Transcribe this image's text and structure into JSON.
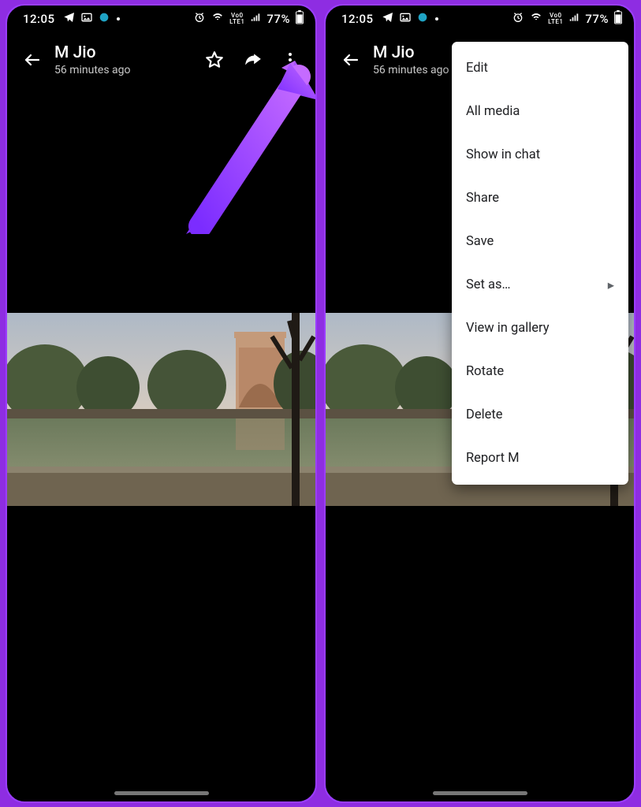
{
  "status": {
    "time": "12:05",
    "battery": "77%"
  },
  "header": {
    "title": "M Jio",
    "subtitle": "56 minutes ago"
  },
  "menu": {
    "items": [
      {
        "label": "Edit",
        "submenu": false
      },
      {
        "label": "All media",
        "submenu": false
      },
      {
        "label": "Show in chat",
        "submenu": false
      },
      {
        "label": "Share",
        "submenu": false
      },
      {
        "label": "Save",
        "submenu": false
      },
      {
        "label": "Set as…",
        "submenu": true
      },
      {
        "label": "View in gallery",
        "submenu": false
      },
      {
        "label": "Rotate",
        "submenu": false
      },
      {
        "label": "Delete",
        "submenu": false
      },
      {
        "label": "Report M",
        "submenu": false
      }
    ]
  }
}
